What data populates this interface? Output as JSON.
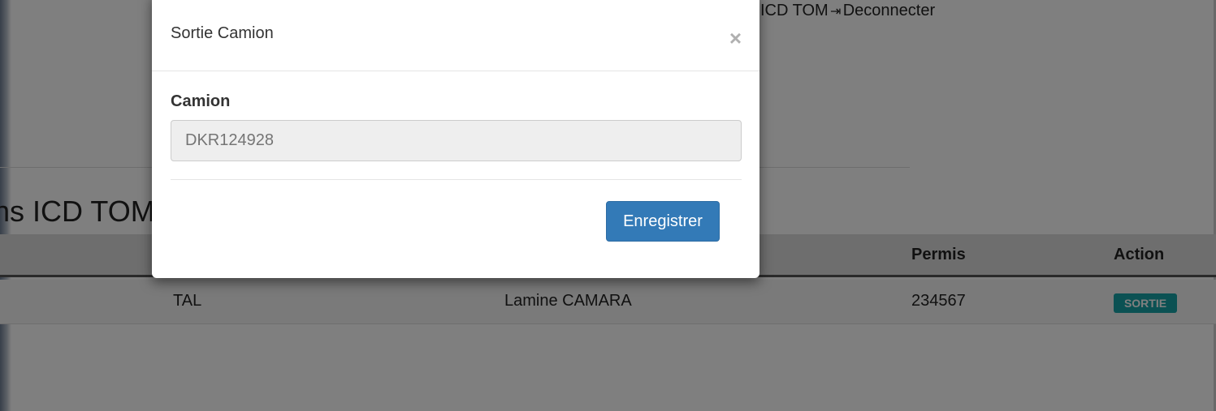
{
  "header": {
    "user_text": "ICD TOM",
    "logout_label": "Deconnecter",
    "logout_icon": "logout-icon"
  },
  "section": {
    "heading": "ions ICD TOM"
  },
  "table": {
    "headers": {
      "permis": "Permis",
      "action": "Action"
    },
    "rows": [
      {
        "col2": "TAL",
        "col3": "Lamine CAMARA",
        "permis": "234567",
        "action_label": "SORTIE"
      }
    ]
  },
  "modal": {
    "title": "Sortie Camion",
    "close_glyph": "×",
    "field_label": "Camion",
    "field_placeholder": "DKR124928",
    "save_label": "Enregistrer"
  },
  "colors": {
    "primary": "#337ab7",
    "badge": "#17a2a7"
  }
}
